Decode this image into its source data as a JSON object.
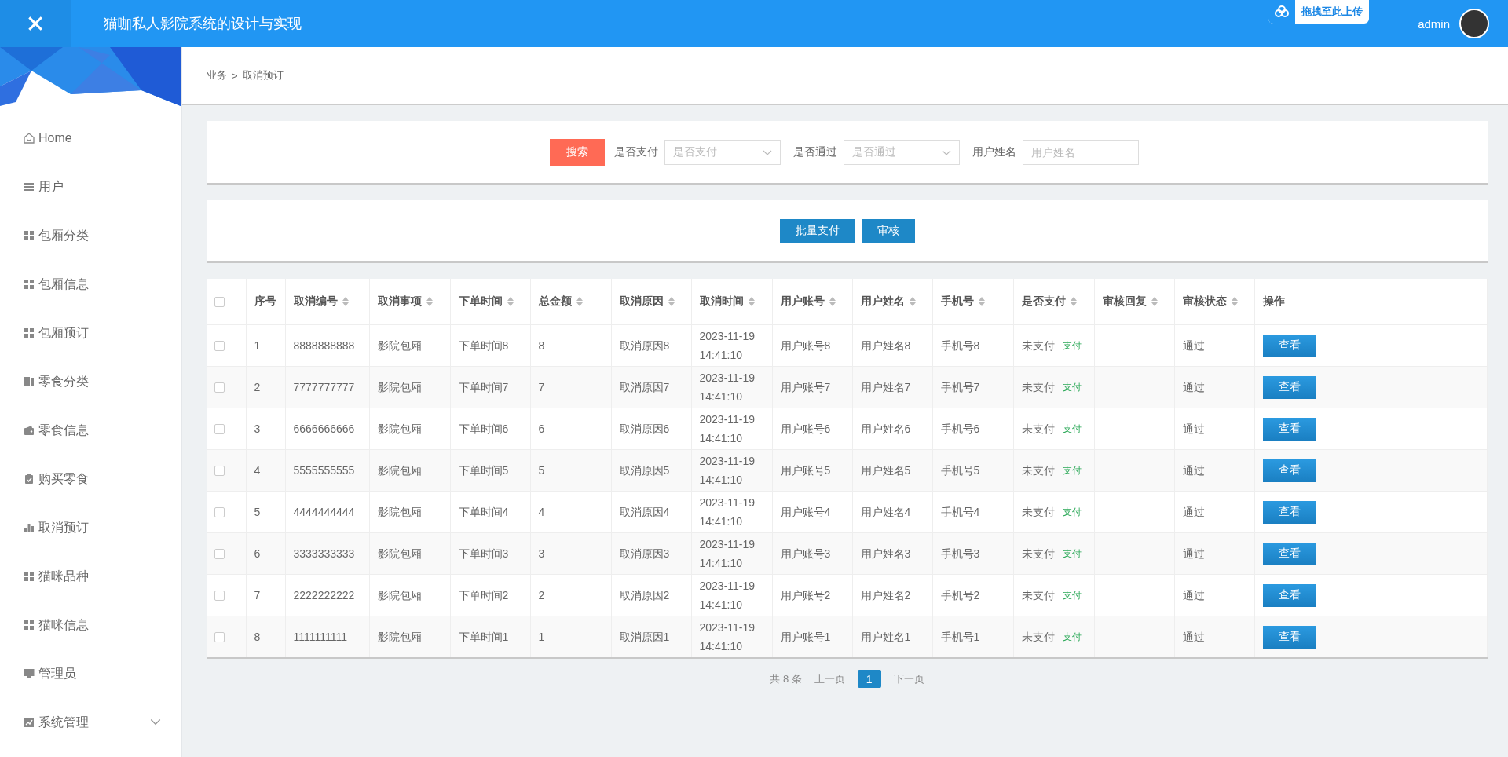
{
  "header": {
    "close_glyph": "✕",
    "title": "猫咖私人影院系统的设计与实现",
    "upload_badge": "拖拽至此上传",
    "user": "admin"
  },
  "sidebar": {
    "items": [
      {
        "label": "Home",
        "selected": false
      },
      {
        "label": "用户",
        "selected": false
      },
      {
        "label": "包厢分类",
        "selected": false
      },
      {
        "label": "包厢信息",
        "selected": false
      },
      {
        "label": "包厢预订",
        "selected": false
      },
      {
        "label": "零食分类",
        "selected": false
      },
      {
        "label": "零食信息",
        "selected": false
      },
      {
        "label": "购买零食",
        "selected": false
      },
      {
        "label": "取消预订",
        "selected": false
      },
      {
        "label": "猫咪品种",
        "selected": false
      },
      {
        "label": "猫咪信息",
        "selected": false
      },
      {
        "label": "管理员",
        "selected": false
      },
      {
        "label": "系统管理",
        "selected": false,
        "expanded": false
      }
    ]
  },
  "breadcrumb": [
    "业务",
    "取消预订"
  ],
  "breadcrumb_separator": ">",
  "search": {
    "button": "搜索",
    "filters": [
      {
        "kind": "select",
        "label": "是否支付",
        "placeholder": "是否支付"
      },
      {
        "kind": "select",
        "label": "是否通过",
        "placeholder": "是否通过"
      },
      {
        "kind": "input",
        "label": "用户姓名",
        "placeholder": "用户姓名"
      }
    ]
  },
  "actions": [
    "批量支付",
    "审核"
  ],
  "table": {
    "select_all_checked": false,
    "columns": [
      {
        "label": "序号",
        "sortable": false
      },
      {
        "label": "取消编号",
        "sortable": true
      },
      {
        "label": "取消事项",
        "sortable": true
      },
      {
        "label": "下单时间",
        "sortable": true
      },
      {
        "label": "总金额",
        "sortable": true
      },
      {
        "label": "取消原因",
        "sortable": true
      },
      {
        "label": "取消时间",
        "sortable": true
      },
      {
        "label": "用户账号",
        "sortable": true
      },
      {
        "label": "用户姓名",
        "sortable": true
      },
      {
        "label": "手机号",
        "sortable": true
      },
      {
        "label": "是否支付",
        "sortable": true
      },
      {
        "label": "审核回复",
        "sortable": true
      },
      {
        "label": "审核状态",
        "sortable": true
      },
      {
        "label": "操作",
        "sortable": false
      }
    ],
    "rows": [
      {
        "checked": false,
        "cells": [
          "1",
          "8888888888",
          "影院包厢",
          "下单时间8",
          "8",
          "取消原因8",
          "2023-11-19 14:41:10",
          "用户账号8",
          "用户姓名8",
          "手机号8"
        ],
        "paid": "未支付",
        "pay_link": "支付",
        "status": "通过",
        "view": "查看"
      },
      {
        "checked": false,
        "cells": [
          "2",
          "7777777777",
          "影院包厢",
          "下单时间7",
          "7",
          "取消原因7",
          "2023-11-19 14:41:10",
          "用户账号7",
          "用户姓名7",
          "手机号7"
        ],
        "paid": "未支付",
        "pay_link": "支付",
        "status": "通过",
        "view": "查看"
      },
      {
        "checked": false,
        "cells": [
          "3",
          "6666666666",
          "影院包厢",
          "下单时间6",
          "6",
          "取消原因6",
          "2023-11-19 14:41:10",
          "用户账号6",
          "用户姓名6",
          "手机号6"
        ],
        "paid": "未支付",
        "pay_link": "支付",
        "status": "通过",
        "view": "查看"
      },
      {
        "checked": false,
        "cells": [
          "4",
          "5555555555",
          "影院包厢",
          "下单时间5",
          "5",
          "取消原因5",
          "2023-11-19 14:41:10",
          "用户账号5",
          "用户姓名5",
          "手机号5"
        ],
        "paid": "未支付",
        "pay_link": "支付",
        "status": "通过",
        "view": "查看"
      },
      {
        "checked": false,
        "cells": [
          "5",
          "4444444444",
          "影院包厢",
          "下单时间4",
          "4",
          "取消原因4",
          "2023-11-19 14:41:10",
          "用户账号4",
          "用户姓名4",
          "手机号4"
        ],
        "paid": "未支付",
        "pay_link": "支付",
        "status": "通过",
        "view": "查看"
      },
      {
        "checked": false,
        "cells": [
          "6",
          "3333333333",
          "影院包厢",
          "下单时间3",
          "3",
          "取消原因3",
          "2023-11-19 14:41:10",
          "用户账号3",
          "用户姓名3",
          "手机号3"
        ],
        "paid": "未支付",
        "pay_link": "支付",
        "status": "通过",
        "view": "查看"
      },
      {
        "checked": false,
        "cells": [
          "7",
          "2222222222",
          "影院包厢",
          "下单时间2",
          "2",
          "取消原因2",
          "2023-11-19 14:41:10",
          "用户账号2",
          "用户姓名2",
          "手机号2"
        ],
        "paid": "未支付",
        "pay_link": "支付",
        "status": "通过",
        "view": "查看"
      },
      {
        "checked": false,
        "cells": [
          "8",
          "1111111111",
          "影院包厢",
          "下单时间1",
          "1",
          "取消原因1",
          "2023-11-19 14:41:10",
          "用户账号1",
          "用户姓名1",
          "手机号1"
        ],
        "paid": "未支付",
        "pay_link": "支付",
        "status": "通过",
        "view": "查看"
      }
    ]
  },
  "pagination": {
    "total": "共 8 条",
    "prev": "上一页",
    "pages": [
      {
        "label": "1",
        "selected": true
      }
    ],
    "next": "下一页"
  }
}
